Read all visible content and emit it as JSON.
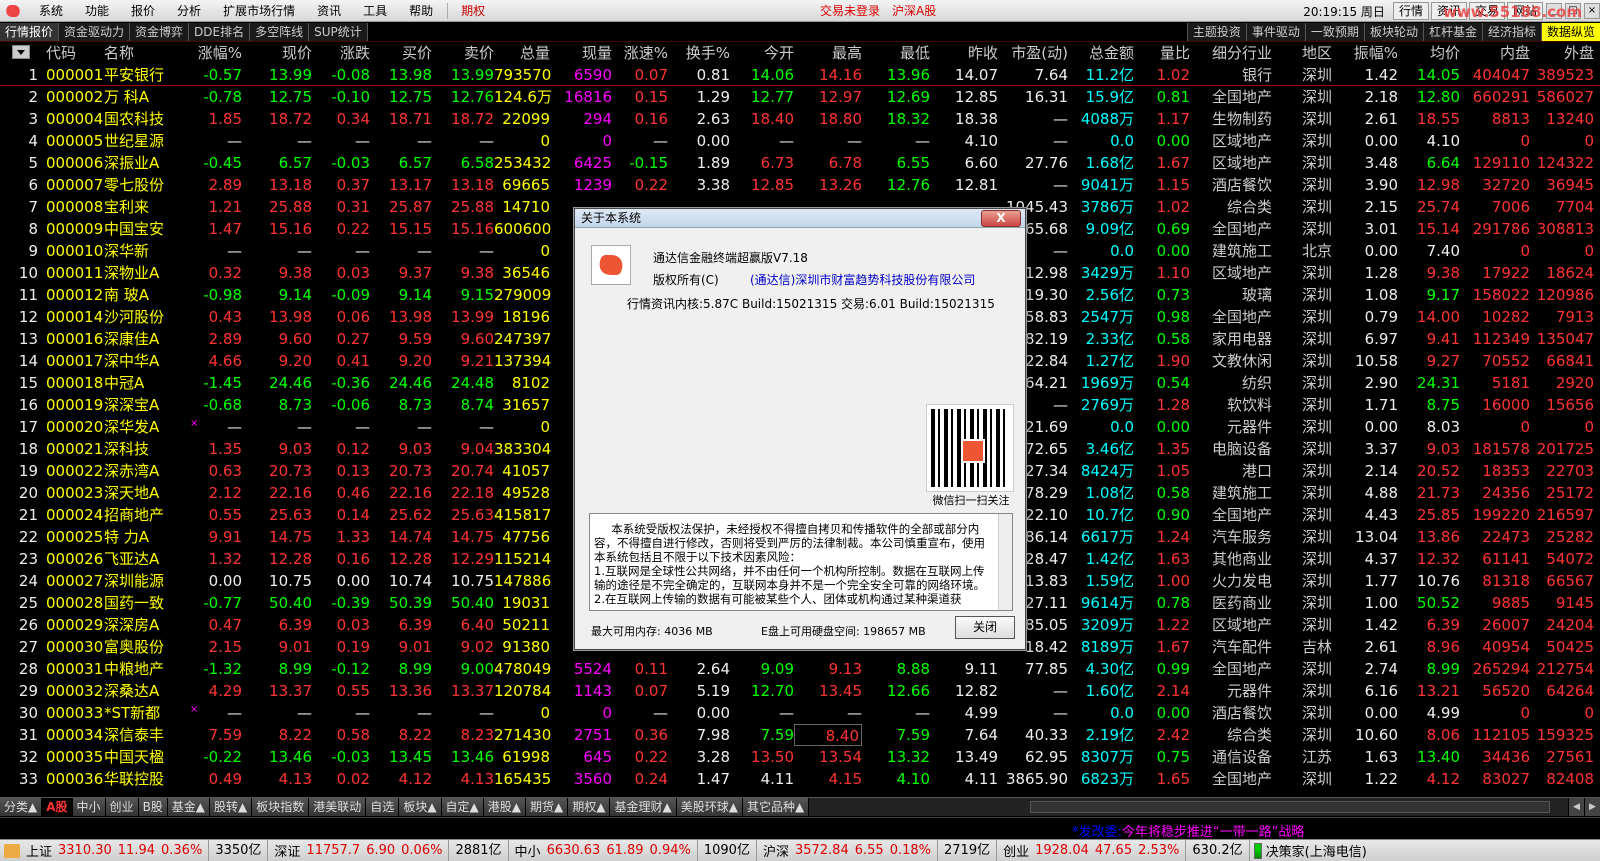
{
  "menu": {
    "items": [
      "系统",
      "功能",
      "报价",
      "分析",
      "扩展市场行情",
      "资讯",
      "工具",
      "帮助"
    ],
    "option": "期权",
    "status": [
      "交易未登录",
      "沪深A股"
    ],
    "time": "20:19:15 周日",
    "right_buttons": [
      "行情",
      "资讯",
      "交易",
      "网站"
    ],
    "watermark": "www.55188.com"
  },
  "toolbar": {
    "left": [
      "行情报价",
      "资金驱动力",
      "资金博弈",
      "DDE排名",
      "多空阵线",
      "SUP统计"
    ],
    "right": [
      "主题投资",
      "事件驱动",
      "一致预期",
      "板块轮动",
      "杠杆基金",
      "经济指标",
      "数据纵览"
    ]
  },
  "columns": [
    "代码",
    "名称",
    "涨幅%",
    "现价",
    "涨跌",
    "买价",
    "卖价",
    "总量",
    "现量",
    "涨速%",
    "换手%",
    "今开",
    "最高",
    "最低",
    "昨收",
    "市盈(动)",
    "总金额",
    "量比",
    "细分行业",
    "地区",
    "振幅%",
    "均价",
    "内盘",
    "外盘"
  ],
  "rows": [
    [
      "1",
      "000001",
      "平安银行",
      "-0.57",
      "13.99",
      "-0.08",
      "13.98",
      "13.99",
      "793570",
      "6590",
      "0.07",
      "0.81",
      "14.06",
      "14.16",
      "13.96",
      "14.07",
      "7.64",
      "11.2亿",
      "1.02",
      "银行",
      "深圳",
      "1.42",
      "14.05",
      "404047",
      "389523"
    ],
    [
      "2",
      "000002",
      "万 科A",
      "-0.78",
      "12.75",
      "-0.10",
      "12.75",
      "12.76",
      "124.6万",
      "16816",
      "0.15",
      "1.29",
      "12.77",
      "12.97",
      "12.69",
      "12.85",
      "16.31",
      "15.9亿",
      "0.81",
      "全国地产",
      "深圳",
      "2.18",
      "12.80",
      "660291",
      "586027"
    ],
    [
      "3",
      "000004",
      "国农科技",
      "1.85",
      "18.72",
      "0.34",
      "18.71",
      "18.72",
      "22099",
      "294",
      "0.16",
      "2.63",
      "18.40",
      "18.80",
      "18.32",
      "18.38",
      "—",
      "4088万",
      "1.17",
      "生物制药",
      "深圳",
      "2.61",
      "18.55",
      "8813",
      "13240"
    ],
    [
      "4",
      "000005",
      "世纪星源",
      "—",
      "—",
      "—",
      "—",
      "—",
      "0",
      "0",
      "—",
      "0.00",
      "—",
      "—",
      "—",
      "4.10",
      "—",
      "0.0",
      "0.00",
      "区域地产",
      "深圳",
      "0.00",
      "4.10",
      "0",
      "0"
    ],
    [
      "5",
      "000006",
      "深振业A",
      "-0.45",
      "6.57",
      "-0.03",
      "6.57",
      "6.58",
      "253432",
      "6425",
      "-0.15",
      "1.89",
      "6.73",
      "6.78",
      "6.55",
      "6.60",
      "27.76",
      "1.68亿",
      "1.67",
      "区域地产",
      "深圳",
      "3.48",
      "6.64",
      "129110",
      "124322"
    ],
    [
      "6",
      "000007",
      "零七股份",
      "2.89",
      "13.18",
      "0.37",
      "13.17",
      "13.18",
      "69665",
      "1239",
      "0.22",
      "3.38",
      "12.85",
      "13.26",
      "12.76",
      "12.81",
      "—",
      "9041万",
      "1.15",
      "酒店餐饮",
      "深圳",
      "3.90",
      "12.98",
      "32720",
      "36945"
    ],
    [
      "7",
      "000008",
      "宝利来",
      "1.21",
      "25.88",
      "0.31",
      "25.87",
      "25.88",
      "14710",
      "",
      "",
      "",
      "",
      "",
      "",
      "",
      "1045.43",
      "3786万",
      "1.02",
      "综合类",
      "深圳",
      "2.15",
      "25.74",
      "7006",
      "7704"
    ],
    [
      "8",
      "000009",
      "中国宝安",
      "1.47",
      "15.16",
      "0.22",
      "15.15",
      "15.16",
      "600600",
      "",
      "",
      "",
      "",
      "",
      "",
      "",
      "65.68",
      "9.09亿",
      "0.69",
      "全国地产",
      "深圳",
      "3.01",
      "15.14",
      "291786",
      "308813"
    ],
    [
      "9",
      "000010",
      "深华新",
      "—",
      "—",
      "—",
      "—",
      "—",
      "0",
      "",
      "",
      "",
      "",
      "",
      "",
      "",
      "—",
      "0.0",
      "0.00",
      "建筑施工",
      "北京",
      "0.00",
      "7.40",
      "0",
      "0"
    ],
    [
      "10",
      "000011",
      "深物业A",
      "0.32",
      "9.38",
      "0.03",
      "9.37",
      "9.38",
      "36546",
      "",
      "",
      "",
      "",
      "",
      "",
      "",
      "12.98",
      "3429万",
      "1.10",
      "区域地产",
      "深圳",
      "1.28",
      "9.38",
      "17922",
      "18624"
    ],
    [
      "11",
      "000012",
      "南 玻A",
      "-0.98",
      "9.14",
      "-0.09",
      "9.14",
      "9.15",
      "279009",
      "",
      "",
      "",
      "",
      "",
      "",
      "",
      "19.30",
      "2.56亿",
      "0.73",
      "玻璃",
      "深圳",
      "1.08",
      "9.17",
      "158022",
      "120986"
    ],
    [
      "12",
      "000014",
      "沙河股份",
      "0.43",
      "13.98",
      "0.06",
      "13.98",
      "13.99",
      "18196",
      "",
      "",
      "",
      "",
      "",
      "",
      "",
      "58.83",
      "2547万",
      "0.98",
      "全国地产",
      "深圳",
      "0.79",
      "14.00",
      "10282",
      "7913"
    ],
    [
      "13",
      "000016",
      "深康佳A",
      "2.89",
      "9.60",
      "0.27",
      "9.59",
      "9.60",
      "247397",
      "",
      "",
      "",
      "",
      "",
      "",
      "",
      "82.19",
      "2.33亿",
      "0.58",
      "家用电器",
      "深圳",
      "6.97",
      "9.41",
      "112349",
      "135047"
    ],
    [
      "14",
      "000017",
      "深中华A",
      "4.66",
      "9.20",
      "0.41",
      "9.20",
      "9.21",
      "137394",
      "",
      "",
      "",
      "",
      "",
      "",
      "",
      "22.84",
      "1.27亿",
      "1.90",
      "文教休闲",
      "深圳",
      "10.58",
      "9.27",
      "70552",
      "66841"
    ],
    [
      "15",
      "000018",
      "中冠A",
      "-1.45",
      "24.46",
      "-0.36",
      "24.46",
      "24.48",
      "8102",
      "",
      "",
      "",
      "",
      "",
      "",
      "",
      "64.21",
      "1969万",
      "0.54",
      "纺织",
      "深圳",
      "2.90",
      "24.31",
      "5181",
      "2920"
    ],
    [
      "16",
      "000019",
      "深深宝A",
      "-0.68",
      "8.73",
      "-0.06",
      "8.73",
      "8.74",
      "31657",
      "",
      "",
      "",
      "",
      "",
      "",
      "",
      "—",
      "2769万",
      "1.28",
      "软饮料",
      "深圳",
      "1.71",
      "8.75",
      "16000",
      "15656"
    ],
    [
      "17",
      "000020",
      "深华发A",
      "—",
      "—",
      "—",
      "—",
      "—",
      "0",
      "",
      "",
      "",
      "",
      "",
      "",
      "",
      "21.69",
      "0.0",
      "0.00",
      "元器件",
      "深圳",
      "0.00",
      "8.03",
      "0",
      "0"
    ],
    [
      "18",
      "000021",
      "深科技",
      "1.35",
      "9.03",
      "0.12",
      "9.03",
      "9.04",
      "383304",
      "",
      "",
      "",
      "",
      "",
      "",
      "",
      "72.65",
      "3.46亿",
      "1.35",
      "电脑设备",
      "深圳",
      "3.37",
      "9.03",
      "181578",
      "201725"
    ],
    [
      "19",
      "000022",
      "深赤湾A",
      "0.63",
      "20.73",
      "0.13",
      "20.73",
      "20.74",
      "41057",
      "",
      "",
      "",
      "",
      "",
      "",
      "",
      "27.34",
      "8424万",
      "1.05",
      "港口",
      "深圳",
      "2.14",
      "20.52",
      "18353",
      "22703"
    ],
    [
      "20",
      "000023",
      "深天地A",
      "2.12",
      "22.16",
      "0.46",
      "22.16",
      "22.18",
      "49528",
      "",
      "",
      "",
      "",
      "",
      "",
      "",
      "78.29",
      "1.08亿",
      "0.58",
      "建筑施工",
      "深圳",
      "4.88",
      "21.73",
      "24356",
      "25172"
    ],
    [
      "21",
      "000024",
      "招商地产",
      "0.55",
      "25.63",
      "0.14",
      "25.62",
      "25.63",
      "415817",
      "",
      "",
      "",
      "",
      "",
      "",
      "",
      "22.10",
      "10.7亿",
      "0.90",
      "全国地产",
      "深圳",
      "4.43",
      "25.85",
      "199220",
      "216597"
    ],
    [
      "22",
      "000025",
      "特 力A",
      "9.91",
      "14.75",
      "1.33",
      "14.74",
      "14.75",
      "47756",
      "",
      "",
      "",
      "",
      "",
      "",
      "",
      "86.14",
      "6617万",
      "1.24",
      "汽车服务",
      "深圳",
      "13.04",
      "13.86",
      "22473",
      "25282"
    ],
    [
      "23",
      "000026",
      "飞亚达A",
      "1.32",
      "12.28",
      "0.16",
      "12.28",
      "12.29",
      "115214",
      "",
      "",
      "",
      "",
      "",
      "",
      "",
      "28.47",
      "1.42亿",
      "1.63",
      "其他商业",
      "深圳",
      "4.37",
      "12.32",
      "61141",
      "54072"
    ],
    [
      "24",
      "000027",
      "深圳能源",
      "0.00",
      "10.75",
      "0.00",
      "10.74",
      "10.75",
      "147886",
      "",
      "",
      "",
      "",
      "",
      "",
      "",
      "13.83",
      "1.59亿",
      "1.00",
      "火力发电",
      "深圳",
      "1.77",
      "10.76",
      "81318",
      "66567"
    ],
    [
      "25",
      "000028",
      "国药一致",
      "-0.77",
      "50.40",
      "-0.39",
      "50.39",
      "50.40",
      "19031",
      "",
      "",
      "",
      "",
      "",
      "",
      "",
      "27.11",
      "9614万",
      "0.78",
      "医药商业",
      "深圳",
      "1.00",
      "50.52",
      "9885",
      "9145"
    ],
    [
      "26",
      "000029",
      "深深房A",
      "0.47",
      "6.39",
      "0.03",
      "6.39",
      "6.40",
      "50211",
      "",
      "",
      "",
      "",
      "",
      "",
      "",
      "85.05",
      "3209万",
      "1.22",
      "区域地产",
      "深圳",
      "1.42",
      "6.39",
      "26007",
      "24204"
    ],
    [
      "27",
      "000030",
      "富奥股份",
      "2.15",
      "9.01",
      "0.19",
      "9.01",
      "9.02",
      "91380",
      "",
      "",
      "",
      "",
      "",
      "",
      "",
      "18.42",
      "8189万",
      "1.67",
      "汽车配件",
      "吉林",
      "2.61",
      "8.96",
      "40954",
      "50425"
    ],
    [
      "28",
      "000031",
      "中粮地产",
      "-1.32",
      "8.99",
      "-0.12",
      "8.99",
      "9.00",
      "478049",
      "5524",
      "0.11",
      "2.64",
      "9.09",
      "9.13",
      "8.88",
      "9.11",
      "77.85",
      "4.30亿",
      "0.99",
      "全国地产",
      "深圳",
      "2.74",
      "8.99",
      "265294",
      "212754"
    ],
    [
      "29",
      "000032",
      "深桑达A",
      "4.29",
      "13.37",
      "0.55",
      "13.36",
      "13.37",
      "120784",
      "1143",
      "0.07",
      "5.19",
      "12.70",
      "13.45",
      "12.66",
      "12.82",
      "—",
      "1.60亿",
      "2.14",
      "元器件",
      "深圳",
      "6.16",
      "13.21",
      "56520",
      "64264"
    ],
    [
      "30",
      "000033",
      "*ST新都",
      "—",
      "—",
      "—",
      "—",
      "—",
      "0",
      "0",
      "—",
      "0.00",
      "—",
      "—",
      "—",
      "4.99",
      "—",
      "0.0",
      "0.00",
      "酒店餐饮",
      "深圳",
      "0.00",
      "4.99",
      "0",
      "0"
    ],
    [
      "31",
      "000034",
      "深信泰丰",
      "7.59",
      "8.22",
      "0.58",
      "8.22",
      "8.23",
      "271430",
      "2751",
      "0.36",
      "7.98",
      "7.59",
      "8.40",
      "7.59",
      "7.64",
      "40.33",
      "2.19亿",
      "2.42",
      "综合类",
      "深圳",
      "10.60",
      "8.06",
      "112105",
      "159325"
    ],
    [
      "32",
      "000035",
      "中国天楹",
      "-0.22",
      "13.46",
      "-0.03",
      "13.45",
      "13.46",
      "61998",
      "645",
      "0.22",
      "3.28",
      "13.50",
      "13.54",
      "13.32",
      "13.49",
      "62.95",
      "8307万",
      "0.75",
      "通信设备",
      "江苏",
      "1.63",
      "13.40",
      "34436",
      "27561"
    ],
    [
      "33",
      "000036",
      "华联控股",
      "0.49",
      "4.13",
      "0.02",
      "4.12",
      "4.13",
      "165435",
      "3560",
      "0.24",
      "1.47",
      "4.11",
      "4.15",
      "4.10",
      "4.11",
      "3865.90",
      "6823万",
      "1.65",
      "全国地产",
      "深圳",
      "1.22",
      "4.12",
      "83027",
      "82408"
    ]
  ],
  "market_tabs": [
    "分类▲",
    "A股",
    "中小",
    "创业",
    "B股",
    "基金▲",
    "股转▲",
    "板块指数",
    "港美联动",
    "自选",
    "板块▲",
    "自定▲",
    "港股▲",
    "期货▲",
    "期权▲",
    "基金理财▲",
    "美股环球▲",
    "其它品种▲"
  ],
  "news": {
    "prefix": "*发改委:",
    "text": "今年将稳步推进“一带一路”战略"
  },
  "status_bar": {
    "indices": [
      {
        "name": "上证",
        "value": "3310.30",
        "chg": "11.94",
        "pct": "0.36%",
        "amt": "3350亿"
      },
      {
        "name": "深证",
        "value": "11757.7",
        "chg": "6.90",
        "pct": "0.06%",
        "amt": "2881亿"
      },
      {
        "name": "中小",
        "value": "6630.63",
        "chg": "61.89",
        "pct": "0.94%",
        "amt": "1090亿"
      },
      {
        "name": "沪深",
        "value": "3572.84",
        "chg": "6.55",
        "pct": "0.18%",
        "amt": "2719亿"
      },
      {
        "name": "创业",
        "value": "1928.04",
        "chg": "47.65",
        "pct": "2.53%",
        "amt": "630.2亿"
      }
    ],
    "server": "决策家(上海电信)"
  },
  "dialog": {
    "title": "关于本系统",
    "close_x": "X",
    "product": "通达信金融终端超赢版V7.18",
    "copyright_label": "版权所有(C)",
    "company": "(通达信)深圳市财富趋势科技股份有限公司",
    "build": "行情资讯内核:5.87C Build:15021315 交易:6.01 Build:15021315",
    "qr_caption": "微信扫一扫关注",
    "legal_text": "本系统受版权法保护，未经授权不得擅自拷贝和传播软件的全部或部分内容，不得擅自进行修改，否则将受到严厉的法律制裁。本公司慎重宣布，使用本系统包括且不限于以下技术因素风险：\n1.互联网是全球性公共网络，并不由任何一个机构所控制。数据在互联网上传输的途径是不完全确定的，互联网本身并不是一个完全安全可靠的网络环境。\n2.在互联网上传输的数据有可能被某些个人、团体或机构通过某种渠道获",
    "memory": "最大可用内存: 4036 MB",
    "disk": "E盘上可用硬盘空间: 198657 MB",
    "close_btn": "关闭"
  },
  "colors": {
    "up": "#ff3333",
    "down": "#00ff00",
    "code": "#ffff00",
    "volume": "#ffff00",
    "amount": "#00ffff",
    "cur_vol": "#ff00ff"
  }
}
